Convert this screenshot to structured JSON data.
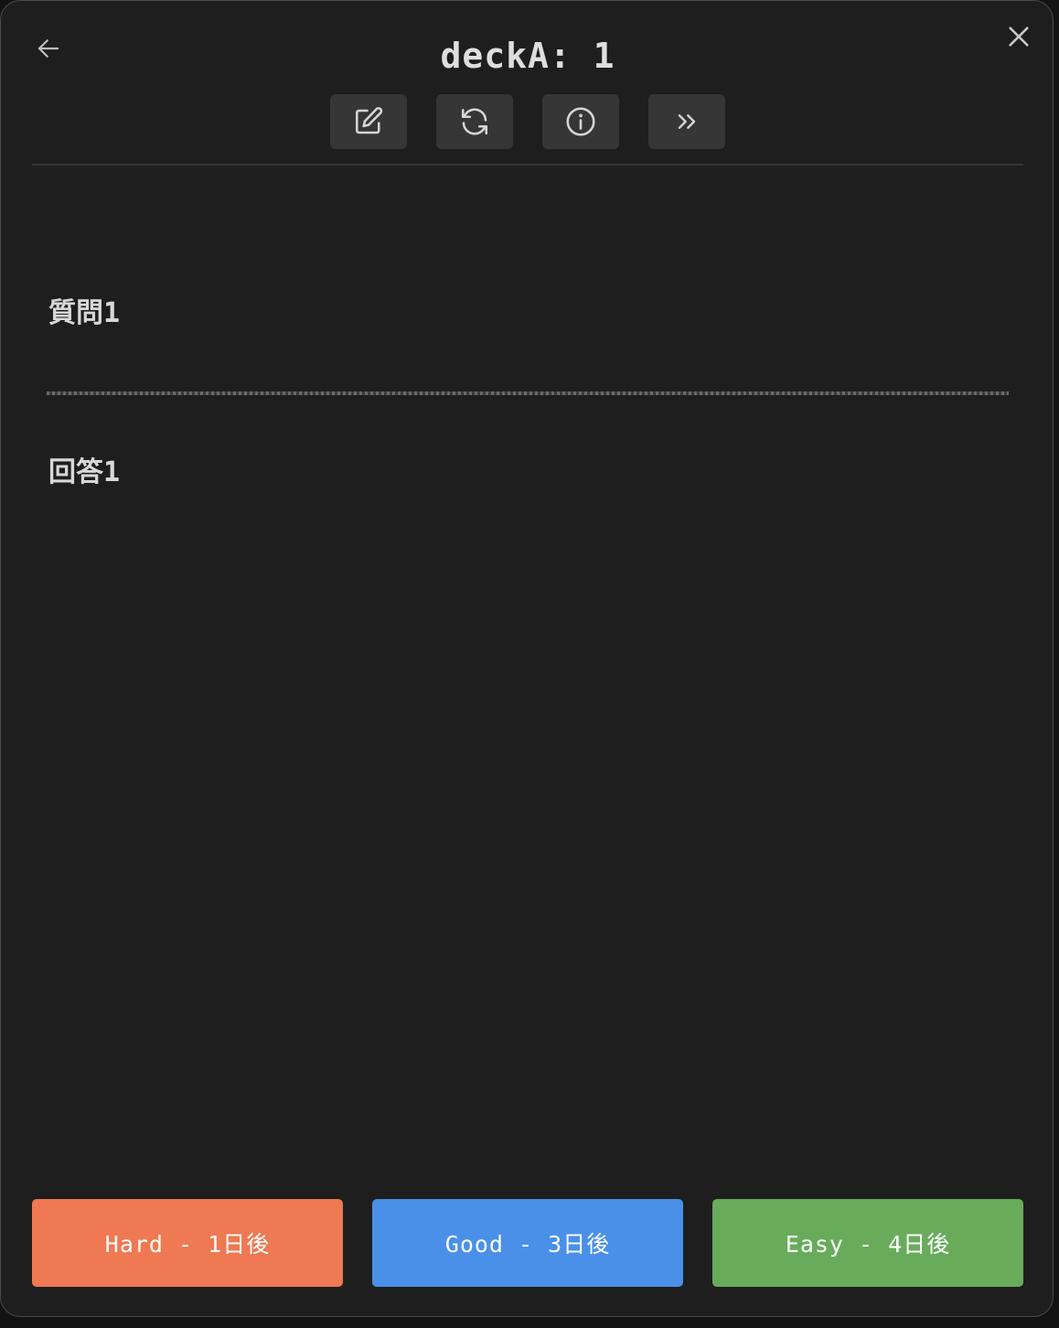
{
  "header": {
    "title": "deckA: 1"
  },
  "toolbar": [
    {
      "name": "edit-button",
      "icon": "edit-icon"
    },
    {
      "name": "reset-button",
      "icon": "refresh-icon"
    },
    {
      "name": "info-button",
      "icon": "info-icon"
    },
    {
      "name": "skip-button",
      "icon": "chevrons-right-icon"
    }
  ],
  "card": {
    "question": "質問1",
    "answer": "回答1"
  },
  "grades": [
    {
      "label": "Hard - 1日後",
      "color": "#ee7952"
    },
    {
      "label": "Good - 3日後",
      "color": "#4a90e8"
    },
    {
      "label": "Easy - 4日後",
      "color": "#68ac5b"
    }
  ],
  "colors": {
    "background": "#1e1e1e",
    "tool_button": "#363636",
    "text": "#dcdcdc"
  }
}
